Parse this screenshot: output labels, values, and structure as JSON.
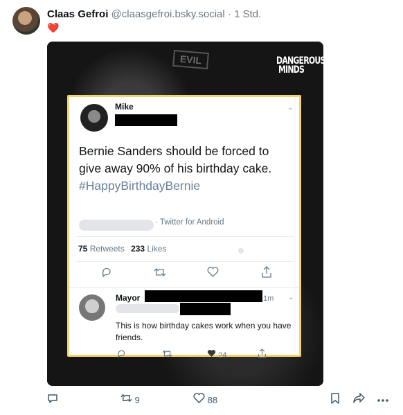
{
  "post": {
    "author_name": "Claas Gefroi",
    "author_handle": "@claasgefroi.bsky.social",
    "time": "1 Std.",
    "separator": "·",
    "emoji": "❤️"
  },
  "image": {
    "sign_text": "EVIL",
    "logo_line1": "DANGEROUS",
    "logo_line2": "MINDS",
    "tweet": {
      "author": "Mike",
      "text_main": "Bernie Sanders should be forced to give away 90% of his birthday cake.",
      "hashtag": "#HappyBirthdayBernie",
      "via": "· Twitter for Android",
      "retweets_count": "75",
      "retweets_label": "Retweets",
      "likes_count": "233",
      "likes_label": "Likes"
    },
    "reply": {
      "author": "Mayor",
      "time": "1m",
      "text": "This is how birthday cakes work when you have friends.",
      "like_count": "24"
    }
  },
  "actions": {
    "repost_count": "9",
    "like_count": "88"
  }
}
